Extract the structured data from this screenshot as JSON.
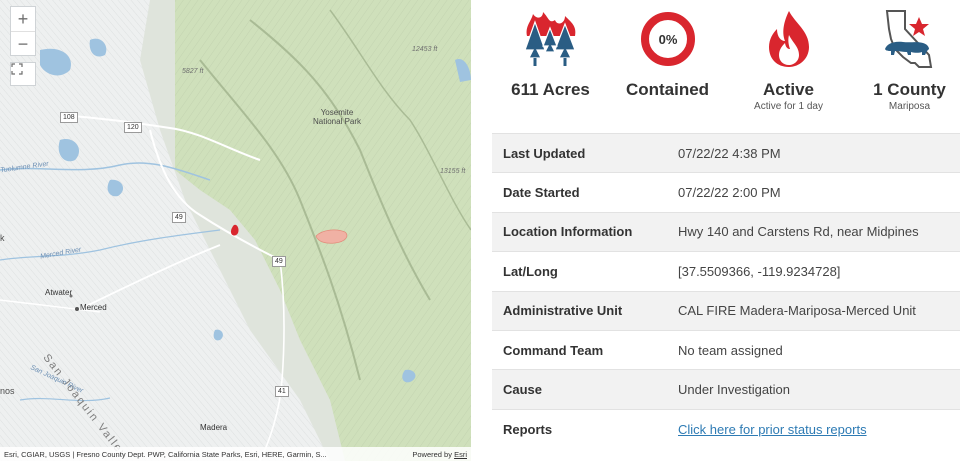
{
  "map": {
    "zoom_in": "+",
    "zoom_out": "−",
    "labels": {
      "yosemite": "Yosemite\nNational Park",
      "atwater": "Atwater",
      "merced": "Merced",
      "madera": "Madera",
      "san_joaquin_valley": "San Joaquin Valley",
      "tuolumne_river": "Tuolumne River",
      "merced_river": "Merced River",
      "san_joaquin_river": "San Joaquin River",
      "elev1": "5827 ft",
      "elev2": "12453 ft",
      "elev3": "13155 ft",
      "partial_k": "k",
      "partial_nos": "nos"
    },
    "shields": [
      "108",
      "120",
      "49",
      "49",
      "41"
    ],
    "attribution": "Esri, CGIAR, USGS | Fresno County Dept. PWP, California State Parks, Esri, HERE, Garmin, S...",
    "powered_by_prefix": "Powered by ",
    "powered_by_link": "Esri"
  },
  "stats": [
    {
      "icon": "burning-trees-icon",
      "value": "611 Acres",
      "sub": ""
    },
    {
      "icon": "containment-ring-icon",
      "ring_label": "0%",
      "value": "Contained",
      "sub": ""
    },
    {
      "icon": "flame-icon",
      "value": "Active",
      "sub": "Active for 1 day"
    },
    {
      "icon": "california-bear-icon",
      "value": "1 County",
      "sub": "Mariposa"
    }
  ],
  "details": [
    {
      "key": "Last Updated",
      "value": "07/22/22 4:38 PM"
    },
    {
      "key": "Date Started",
      "value": "07/22/22 2:00 PM"
    },
    {
      "key": "Location Information",
      "value": "Hwy 140 and Carstens Rd, near Midpines"
    },
    {
      "key": "Lat/Long",
      "value": "[37.5509366, -119.9234728]"
    },
    {
      "key": "Administrative Unit",
      "value": "CAL FIRE Madera-Mariposa-Merced Unit"
    },
    {
      "key": "Command Team",
      "value": "No team assigned"
    },
    {
      "key": "Cause",
      "value": "Under Investigation"
    },
    {
      "key": "Reports",
      "value": "Click here for prior status reports"
    }
  ],
  "colors": {
    "brand_red": "#d9262e",
    "icon_blue": "#2a5d84",
    "park_green": "#c8ddb0",
    "link": "#2e7bb4"
  }
}
